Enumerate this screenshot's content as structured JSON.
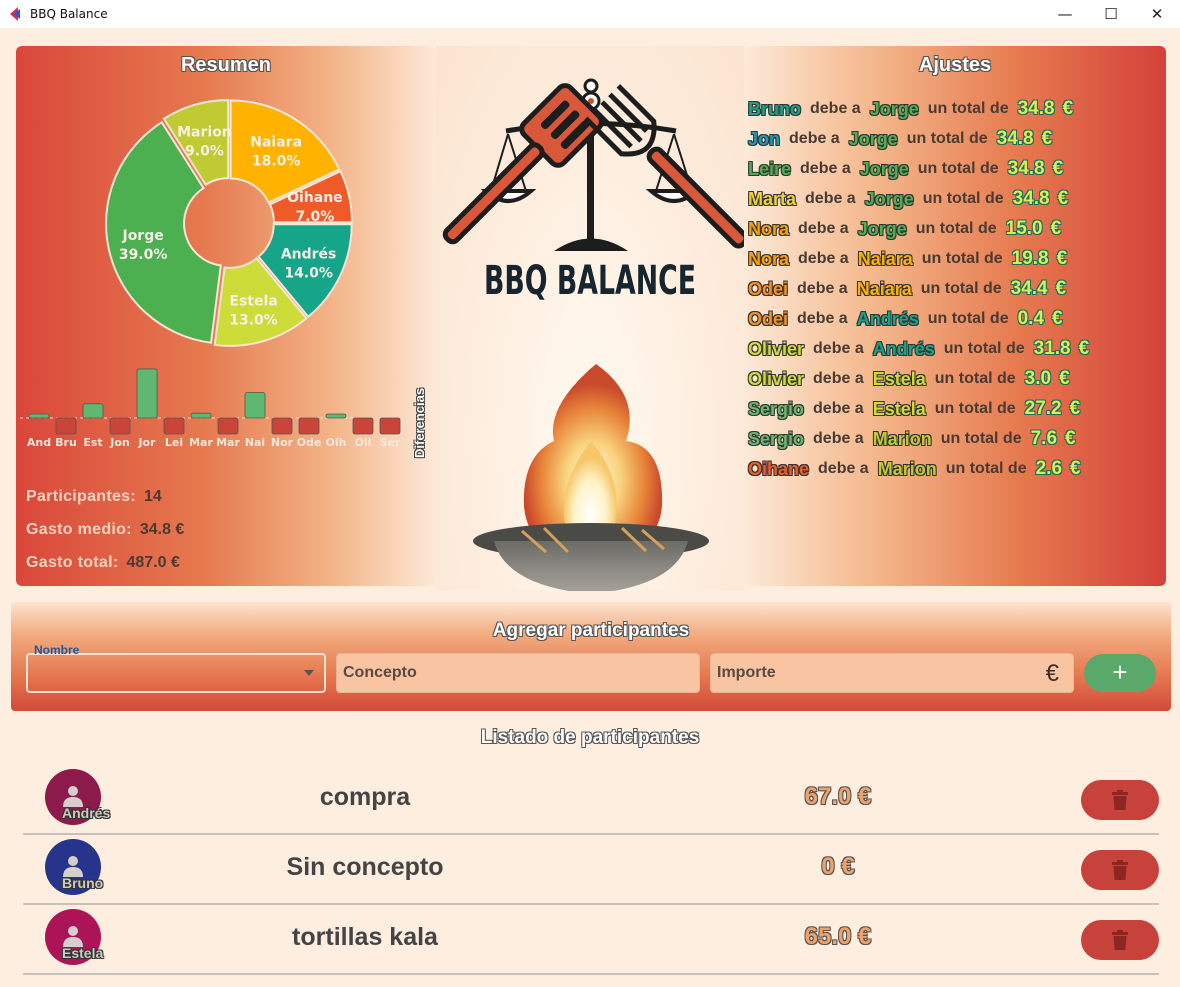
{
  "window": {
    "title": "BBQ Balance",
    "controls": {
      "minimize": "—",
      "maximize": "☐",
      "close": "✕"
    }
  },
  "summary": {
    "title": "Resumen",
    "donut_labels": [
      {
        "name": "Naiara",
        "pct": "18.0%"
      },
      {
        "name": "Oihane",
        "pct": "7.0%"
      },
      {
        "name": "Andrés",
        "pct": "14.0%"
      },
      {
        "name": "Estela",
        "pct": "13.0%"
      },
      {
        "name": "Jorge",
        "pct": "39.0%"
      },
      {
        "name": "Marion",
        "pct": "9.0%"
      }
    ],
    "diff_label": "Diferencias",
    "stats": {
      "participants_label": "Participantes:",
      "participants_value": "14",
      "avg_label": "Gasto medio:",
      "avg_value": "34.8 €",
      "total_label": "Gasto total:",
      "total_value": "487.0 €"
    }
  },
  "chart_data": [
    {
      "type": "pie",
      "categories": [
        "Naiara",
        "Oihane",
        "Andrés",
        "Estela",
        "Jorge",
        "Marion"
      ],
      "values": [
        18.0,
        7.0,
        14.0,
        13.0,
        39.0,
        9.0
      ],
      "colors": [
        "#ffb300",
        "#ef5a28",
        "#17a589",
        "#cddc39",
        "#4caf50",
        "#c0ca33"
      ]
    },
    {
      "type": "bar",
      "categories": [
        "And",
        "Bru",
        "Est",
        "Jon",
        "Jor",
        "Lei",
        "Mar",
        "Mar",
        "Nai",
        "Nor",
        "Ode",
        "Oih",
        "Oli",
        "Ser"
      ],
      "values": [
        0.4,
        -34.8,
        30.2,
        -34.8,
        104.4,
        -34.8,
        10.2,
        -34.8,
        54.2,
        -34.8,
        -34.8,
        2.6,
        -34.8,
        -34.8
      ],
      "title": "",
      "ylabel": "Diferencias",
      "colors": {
        "positive": "#5fb870",
        "negative": "#c9453a"
      }
    }
  ],
  "logo": {
    "text": "BBQ BALANCE"
  },
  "settlements": {
    "title": "Ajustes",
    "owes": "debe a",
    "total": "un total de",
    "currency": "€",
    "rows": [
      {
        "from": "Bruno",
        "to": "Jorge",
        "amount": "34.8",
        "from_color": "#17a589",
        "to_color": "#4caf50"
      },
      {
        "from": "Jon",
        "to": "Jorge",
        "amount": "34.8",
        "from_color": "#1e9bb5",
        "to_color": "#4caf50"
      },
      {
        "from": "Leire",
        "to": "Jorge",
        "amount": "34.8",
        "from_color": "#4caf50",
        "to_color": "#4caf50"
      },
      {
        "from": "Marta",
        "to": "Jorge",
        "amount": "34.8",
        "from_color": "#f2d23c",
        "to_color": "#4caf50"
      },
      {
        "from": "Nora",
        "to": "Jorge",
        "amount": "15.0",
        "from_color": "#ffa000",
        "to_color": "#4caf50"
      },
      {
        "from": "Nora",
        "to": "Naiara",
        "amount": "19.8",
        "from_color": "#ffa000",
        "to_color": "#ffb300"
      },
      {
        "from": "Odei",
        "to": "Naiara",
        "amount": "34.4",
        "from_color": "#ff8f1f",
        "to_color": "#ffb300"
      },
      {
        "from": "Odei",
        "to": "Andrés",
        "amount": "0.4",
        "from_color": "#ff8f1f",
        "to_color": "#17a589"
      },
      {
        "from": "Olivier",
        "to": "Andrés",
        "amount": "31.8",
        "from_color": "#cddc39",
        "to_color": "#17a589"
      },
      {
        "from": "Olivier",
        "to": "Estela",
        "amount": "3.0",
        "from_color": "#cddc39",
        "to_color": "#cddc39"
      },
      {
        "from": "Sergio",
        "to": "Estela",
        "amount": "27.2",
        "from_color": "#66bb6a",
        "to_color": "#cddc39"
      },
      {
        "from": "Sergio",
        "to": "Marion",
        "amount": "7.6",
        "from_color": "#66bb6a",
        "to_color": "#c0ca33"
      },
      {
        "from": "Oihane",
        "to": "Marion",
        "amount": "2.6",
        "from_color": "#ef5a28",
        "to_color": "#c0ca33"
      }
    ]
  },
  "add_form": {
    "title": "Agregar participantes",
    "name_label": "Nombre",
    "name_value": "",
    "concept_placeholder": "Concepto",
    "amount_placeholder": "Importe",
    "amount_suffix": "€",
    "add_label": "+"
  },
  "list": {
    "title": "Listado de participantes",
    "rows": [
      {
        "name": "Andrés",
        "concept": "compra",
        "amount": "67.0 €",
        "avatar_color": "#8c1a4b"
      },
      {
        "name": "Bruno",
        "concept": "Sin concepto",
        "amount": "0 €",
        "avatar_color": "#27348b"
      },
      {
        "name": "Estela",
        "concept": "tortillas kala",
        "amount": "65.0 €",
        "avatar_color": "#ad1457"
      }
    ]
  }
}
